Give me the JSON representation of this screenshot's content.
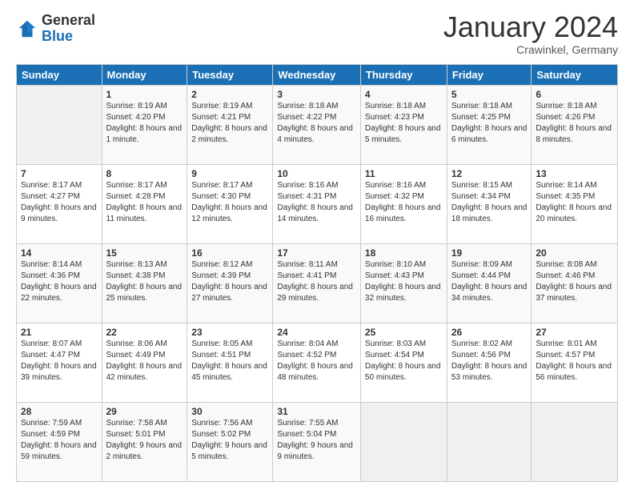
{
  "header": {
    "logo_general": "General",
    "logo_blue": "Blue",
    "month_title": "January 2024",
    "location": "Crawinkel, Germany"
  },
  "days_of_week": [
    "Sunday",
    "Monday",
    "Tuesday",
    "Wednesday",
    "Thursday",
    "Friday",
    "Saturday"
  ],
  "weeks": [
    [
      {
        "day": "",
        "sunrise": "",
        "sunset": "",
        "daylight": "",
        "empty": true
      },
      {
        "day": "1",
        "sunrise": "Sunrise: 8:19 AM",
        "sunset": "Sunset: 4:20 PM",
        "daylight": "Daylight: 8 hours and 1 minute."
      },
      {
        "day": "2",
        "sunrise": "Sunrise: 8:19 AM",
        "sunset": "Sunset: 4:21 PM",
        "daylight": "Daylight: 8 hours and 2 minutes."
      },
      {
        "day": "3",
        "sunrise": "Sunrise: 8:18 AM",
        "sunset": "Sunset: 4:22 PM",
        "daylight": "Daylight: 8 hours and 4 minutes."
      },
      {
        "day": "4",
        "sunrise": "Sunrise: 8:18 AM",
        "sunset": "Sunset: 4:23 PM",
        "daylight": "Daylight: 8 hours and 5 minutes."
      },
      {
        "day": "5",
        "sunrise": "Sunrise: 8:18 AM",
        "sunset": "Sunset: 4:25 PM",
        "daylight": "Daylight: 8 hours and 6 minutes."
      },
      {
        "day": "6",
        "sunrise": "Sunrise: 8:18 AM",
        "sunset": "Sunset: 4:26 PM",
        "daylight": "Daylight: 8 hours and 8 minutes."
      }
    ],
    [
      {
        "day": "7",
        "sunrise": "Sunrise: 8:17 AM",
        "sunset": "Sunset: 4:27 PM",
        "daylight": "Daylight: 8 hours and 9 minutes."
      },
      {
        "day": "8",
        "sunrise": "Sunrise: 8:17 AM",
        "sunset": "Sunset: 4:28 PM",
        "daylight": "Daylight: 8 hours and 11 minutes."
      },
      {
        "day": "9",
        "sunrise": "Sunrise: 8:17 AM",
        "sunset": "Sunset: 4:30 PM",
        "daylight": "Daylight: 8 hours and 12 minutes."
      },
      {
        "day": "10",
        "sunrise": "Sunrise: 8:16 AM",
        "sunset": "Sunset: 4:31 PM",
        "daylight": "Daylight: 8 hours and 14 minutes."
      },
      {
        "day": "11",
        "sunrise": "Sunrise: 8:16 AM",
        "sunset": "Sunset: 4:32 PM",
        "daylight": "Daylight: 8 hours and 16 minutes."
      },
      {
        "day": "12",
        "sunrise": "Sunrise: 8:15 AM",
        "sunset": "Sunset: 4:34 PM",
        "daylight": "Daylight: 8 hours and 18 minutes."
      },
      {
        "day": "13",
        "sunrise": "Sunrise: 8:14 AM",
        "sunset": "Sunset: 4:35 PM",
        "daylight": "Daylight: 8 hours and 20 minutes."
      }
    ],
    [
      {
        "day": "14",
        "sunrise": "Sunrise: 8:14 AM",
        "sunset": "Sunset: 4:36 PM",
        "daylight": "Daylight: 8 hours and 22 minutes."
      },
      {
        "day": "15",
        "sunrise": "Sunrise: 8:13 AM",
        "sunset": "Sunset: 4:38 PM",
        "daylight": "Daylight: 8 hours and 25 minutes."
      },
      {
        "day": "16",
        "sunrise": "Sunrise: 8:12 AM",
        "sunset": "Sunset: 4:39 PM",
        "daylight": "Daylight: 8 hours and 27 minutes."
      },
      {
        "day": "17",
        "sunrise": "Sunrise: 8:11 AM",
        "sunset": "Sunset: 4:41 PM",
        "daylight": "Daylight: 8 hours and 29 minutes."
      },
      {
        "day": "18",
        "sunrise": "Sunrise: 8:10 AM",
        "sunset": "Sunset: 4:43 PM",
        "daylight": "Daylight: 8 hours and 32 minutes."
      },
      {
        "day": "19",
        "sunrise": "Sunrise: 8:09 AM",
        "sunset": "Sunset: 4:44 PM",
        "daylight": "Daylight: 8 hours and 34 minutes."
      },
      {
        "day": "20",
        "sunrise": "Sunrise: 8:08 AM",
        "sunset": "Sunset: 4:46 PM",
        "daylight": "Daylight: 8 hours and 37 minutes."
      }
    ],
    [
      {
        "day": "21",
        "sunrise": "Sunrise: 8:07 AM",
        "sunset": "Sunset: 4:47 PM",
        "daylight": "Daylight: 8 hours and 39 minutes."
      },
      {
        "day": "22",
        "sunrise": "Sunrise: 8:06 AM",
        "sunset": "Sunset: 4:49 PM",
        "daylight": "Daylight: 8 hours and 42 minutes."
      },
      {
        "day": "23",
        "sunrise": "Sunrise: 8:05 AM",
        "sunset": "Sunset: 4:51 PM",
        "daylight": "Daylight: 8 hours and 45 minutes."
      },
      {
        "day": "24",
        "sunrise": "Sunrise: 8:04 AM",
        "sunset": "Sunset: 4:52 PM",
        "daylight": "Daylight: 8 hours and 48 minutes."
      },
      {
        "day": "25",
        "sunrise": "Sunrise: 8:03 AM",
        "sunset": "Sunset: 4:54 PM",
        "daylight": "Daylight: 8 hours and 50 minutes."
      },
      {
        "day": "26",
        "sunrise": "Sunrise: 8:02 AM",
        "sunset": "Sunset: 4:56 PM",
        "daylight": "Daylight: 8 hours and 53 minutes."
      },
      {
        "day": "27",
        "sunrise": "Sunrise: 8:01 AM",
        "sunset": "Sunset: 4:57 PM",
        "daylight": "Daylight: 8 hours and 56 minutes."
      }
    ],
    [
      {
        "day": "28",
        "sunrise": "Sunrise: 7:59 AM",
        "sunset": "Sunset: 4:59 PM",
        "daylight": "Daylight: 8 hours and 59 minutes."
      },
      {
        "day": "29",
        "sunrise": "Sunrise: 7:58 AM",
        "sunset": "Sunset: 5:01 PM",
        "daylight": "Daylight: 9 hours and 2 minutes."
      },
      {
        "day": "30",
        "sunrise": "Sunrise: 7:56 AM",
        "sunset": "Sunset: 5:02 PM",
        "daylight": "Daylight: 9 hours and 5 minutes."
      },
      {
        "day": "31",
        "sunrise": "Sunrise: 7:55 AM",
        "sunset": "Sunset: 5:04 PM",
        "daylight": "Daylight: 9 hours and 9 minutes."
      },
      {
        "day": "",
        "sunrise": "",
        "sunset": "",
        "daylight": "",
        "empty": true
      },
      {
        "day": "",
        "sunrise": "",
        "sunset": "",
        "daylight": "",
        "empty": true
      },
      {
        "day": "",
        "sunrise": "",
        "sunset": "",
        "daylight": "",
        "empty": true
      }
    ]
  ]
}
